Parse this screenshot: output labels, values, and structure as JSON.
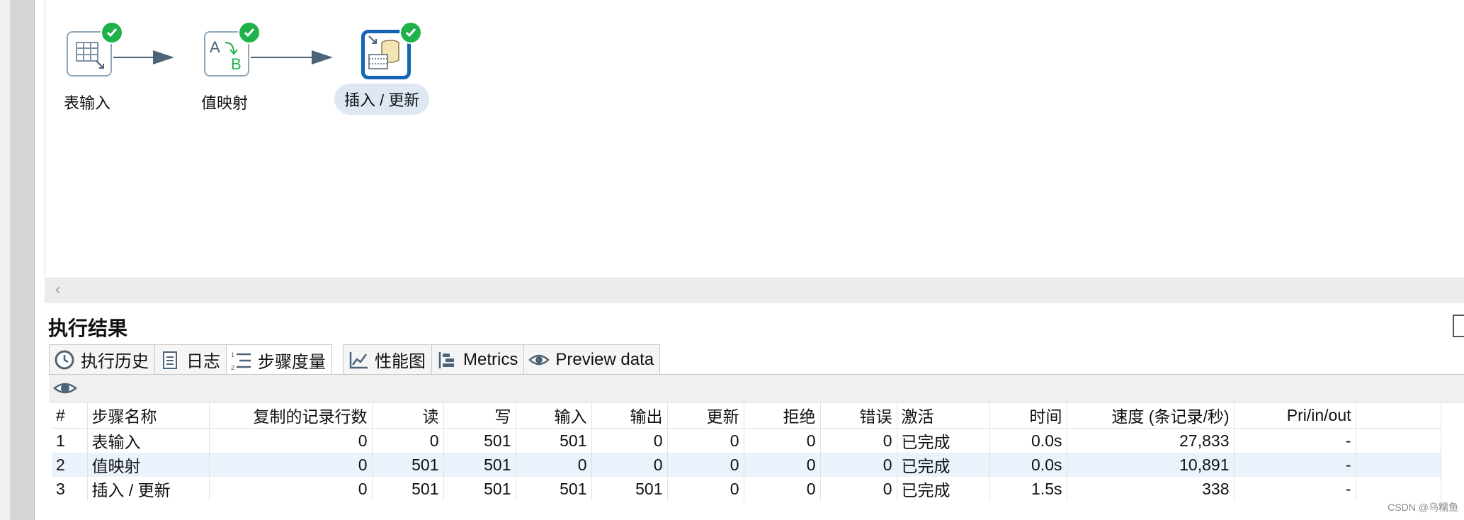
{
  "canvas": {
    "steps": [
      {
        "label": "表输入",
        "icon": "table-input-icon",
        "status": "success"
      },
      {
        "label": "值映射",
        "icon": "value-mapper-icon",
        "status": "success"
      },
      {
        "label": "插入 / 更新",
        "icon": "insert-update-icon",
        "status": "success",
        "selected": true
      }
    ]
  },
  "results": {
    "title": "执行结果",
    "tabs": [
      {
        "label": "执行历史",
        "icon": "clock-icon"
      },
      {
        "label": "日志",
        "icon": "log-icon"
      },
      {
        "label": "步骤度量",
        "icon": "step-metrics-icon",
        "active": true
      },
      {
        "label": "性能图",
        "icon": "chart-icon"
      },
      {
        "label": "Metrics",
        "icon": "metrics-icon"
      },
      {
        "label": "Preview data",
        "icon": "eye-icon"
      }
    ],
    "columns": [
      "#",
      "步骤名称",
      "复制的记录行数",
      "读",
      "写",
      "输入",
      "输出",
      "更新",
      "拒绝",
      "错误",
      "激活",
      "时间",
      "速度 (条记录/秒)",
      "Pri/in/out"
    ],
    "rows": [
      [
        "1",
        "表输入",
        "0",
        "0",
        "501",
        "501",
        "0",
        "0",
        "0",
        "0",
        "已完成",
        "0.0s",
        "27,833",
        "-"
      ],
      [
        "2",
        "值映射",
        "0",
        "501",
        "501",
        "0",
        "0",
        "0",
        "0",
        "0",
        "已完成",
        "0.0s",
        "10,891",
        "-"
      ],
      [
        "3",
        "插入 / 更新",
        "0",
        "501",
        "501",
        "501",
        "501",
        "0",
        "0",
        "0",
        "已完成",
        "1.5s",
        "338",
        "-"
      ]
    ]
  },
  "watermark": "CSDN @乌糯鱼",
  "colors": {
    "accent": "#1565b6",
    "success": "#20b24a",
    "hop": "#4d6478",
    "selected_row": "#eaf3fb"
  }
}
